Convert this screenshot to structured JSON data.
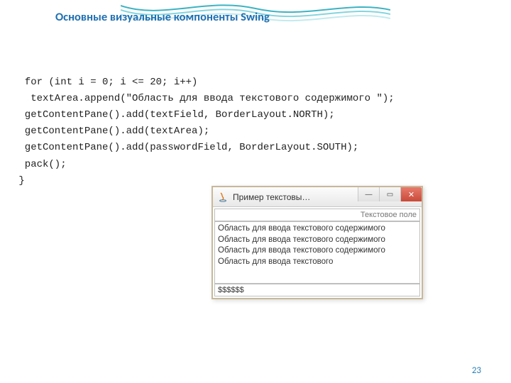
{
  "slide": {
    "title": "Основные визуальные компоненты Swing",
    "page_number": "23"
  },
  "code": {
    "line1": "  for (int i = 0; i <= 20; i++)",
    "line2": "   textArea.append(\"Область для ввода текстового содержимого \");",
    "line3": "  getContentPane().add(textField, BorderLayout.NORTH);",
    "line4": "  getContentPane().add(textArea);",
    "line5": "  getContentPane().add(passwordField, BorderLayout.SOUTH);",
    "line6": "  pack();",
    "line7": " }"
  },
  "window": {
    "title": "Пример текстовы…",
    "north_placeholder": "Текстовое поле",
    "center_text": "Область для ввода текстового содержимого Область для ввода текстового содержимого Область для ввода текстового содержимого Область для ввода текстового",
    "south_value": "$$$$$$",
    "buttons": {
      "minimize": "—",
      "maximize": "▭",
      "close": "✕"
    }
  }
}
